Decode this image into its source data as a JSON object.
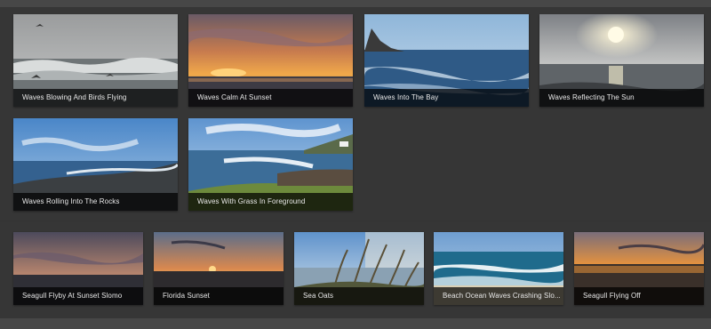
{
  "gallery_row_1": [
    {
      "title": "Waves Blowing And Birds Flying"
    },
    {
      "title": "Waves Calm At Sunset"
    },
    {
      "title": "Waves Into The Bay"
    },
    {
      "title": "Waves Reflecting The Sun"
    }
  ],
  "gallery_row_2": [
    {
      "title": "Waves Rolling Into The Rocks"
    },
    {
      "title": "Waves With Grass In Foreground"
    }
  ],
  "gallery_row_3": [
    {
      "title": "Seagull Flyby At Sunset Slomo"
    },
    {
      "title": "Florida Sunset"
    },
    {
      "title": "Sea Oats"
    },
    {
      "title": "Beach Ocean Waves Crashing Slo..."
    },
    {
      "title": "Seagull Flying Off"
    }
  ]
}
